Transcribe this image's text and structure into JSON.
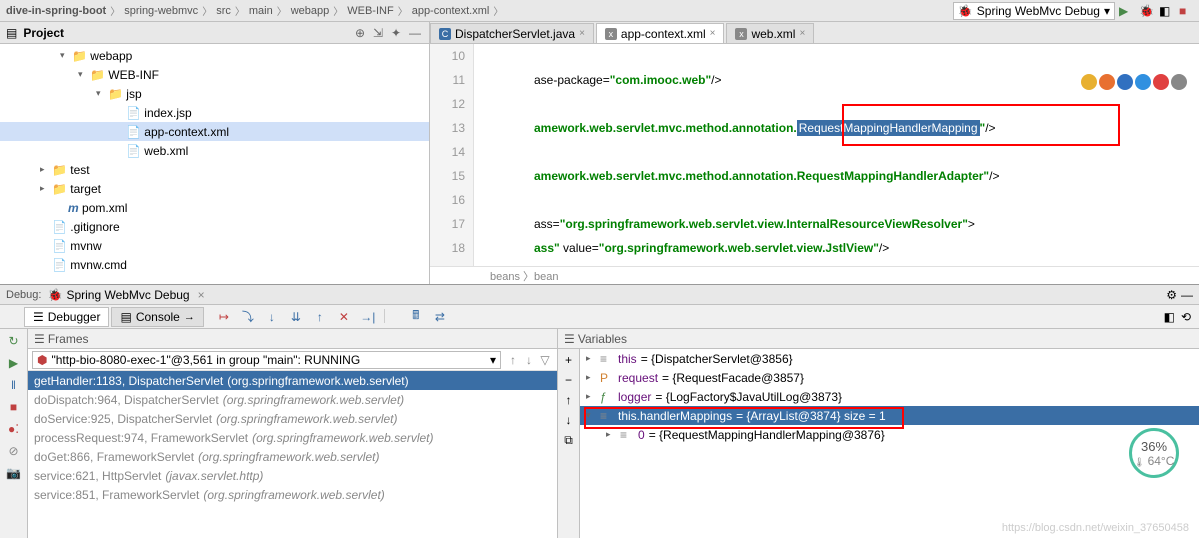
{
  "breadcrumb": [
    "dive-in-spring-boot",
    "spring-webmvc",
    "src",
    "main",
    "webapp",
    "WEB-INF",
    "app-context.xml"
  ],
  "run_config": "Spring WebMvc Debug",
  "project_panel": {
    "title": "Project",
    "tree": [
      {
        "indent": 0,
        "icon": "folder",
        "name": "webapp",
        "arrow": "▾"
      },
      {
        "indent": 1,
        "icon": "folder",
        "name": "WEB-INF",
        "arrow": "▾"
      },
      {
        "indent": 2,
        "icon": "folder",
        "name": "jsp",
        "arrow": "▾"
      },
      {
        "indent": 3,
        "icon": "file",
        "name": "index.jsp"
      },
      {
        "indent": 3,
        "icon": "xml",
        "name": "app-context.xml",
        "selected": true
      },
      {
        "indent": 3,
        "icon": "xml",
        "name": "web.xml"
      },
      {
        "indent": -1,
        "icon": "folder",
        "name": "test",
        "arrow": "▸",
        "pad": 40
      },
      {
        "indent": -1,
        "icon": "folder-orange",
        "name": "target",
        "arrow": "▸",
        "pad": 40
      },
      {
        "indent": -1,
        "icon": "maven",
        "name": "pom.xml",
        "pad": 56
      },
      {
        "indent": -1,
        "icon": "file",
        "name": ".gitignore",
        "pad": 40
      },
      {
        "indent": -1,
        "icon": "file",
        "name": "mvnw",
        "pad": 40
      },
      {
        "indent": -1,
        "icon": "file",
        "name": "mvnw.cmd",
        "pad": 40
      }
    ]
  },
  "editor": {
    "tabs": [
      {
        "name": "DispatcherServlet.java",
        "icon": "C"
      },
      {
        "name": "app-context.xml",
        "active": true,
        "icon": "x"
      },
      {
        "name": "web.xml",
        "icon": "x"
      }
    ],
    "lines": [
      {
        "num": 10,
        "text": ""
      },
      {
        "num": 11,
        "parts": [
          {
            "t": "ase-package=",
            "c": "punc"
          },
          {
            "t": "\"com.imooc.web\"",
            "c": "str"
          },
          {
            "t": "/>",
            "c": "punc"
          }
        ]
      },
      {
        "num": 12,
        "text": ""
      },
      {
        "num": 13,
        "parts": [
          {
            "t": "amework.web.servlet.mvc.method.annotation.",
            "c": "str"
          },
          {
            "t": "RequestMappingHandlerMapping",
            "c": "selected-text"
          },
          {
            "t": "\"",
            "c": "str"
          },
          {
            "t": "/>",
            "c": "punc"
          }
        ]
      },
      {
        "num": 14,
        "text": ""
      },
      {
        "num": 15,
        "parts": [
          {
            "t": "amework.web.servlet.mvc.method.annotation.RequestMappingHandlerAdapter\"",
            "c": "str"
          },
          {
            "t": "/>",
            "c": "punc"
          }
        ]
      },
      {
        "num": 16,
        "text": ""
      },
      {
        "num": 17,
        "parts": [
          {
            "t": "ass=",
            "c": "punc"
          },
          {
            "t": "\"org.springframework.web.servlet.view.InternalResourceViewResolver\"",
            "c": "str"
          },
          {
            "t": ">",
            "c": "punc"
          }
        ]
      },
      {
        "num": 18,
        "parts": [
          {
            "t": "ass\"",
            "c": "str"
          },
          {
            "t": " value=",
            "c": "punc"
          },
          {
            "t": "\"org.springframework.web.servlet.view.JstlView\"",
            "c": "str"
          },
          {
            "t": "/>",
            "c": "punc"
          }
        ]
      }
    ],
    "breadcrumb": "beans 〉bean"
  },
  "debug": {
    "header_label": "Debug:",
    "header_title": "Spring WebMvc Debug",
    "tabs": [
      "Debugger",
      "Console"
    ],
    "frames": {
      "title": "Frames",
      "thread": "\"http-bio-8080-exec-1\"@3,561 in group \"main\": RUNNING",
      "list": [
        {
          "method": "getHandler:1183, DispatcherServlet",
          "pkg": "(org.springframework.web.servlet)",
          "selected": true
        },
        {
          "method": "doDispatch:964, DispatcherServlet",
          "pkg": "(org.springframework.web.servlet)",
          "dim": true
        },
        {
          "method": "doService:925, DispatcherServlet",
          "pkg": "(org.springframework.web.servlet)",
          "dim": true
        },
        {
          "method": "processRequest:974, FrameworkServlet",
          "pkg": "(org.springframework.web.servlet)",
          "dim": true
        },
        {
          "method": "doGet:866, FrameworkServlet",
          "pkg": "(org.springframework.web.servlet)",
          "dim": true
        },
        {
          "method": "service:621, HttpServlet",
          "pkg": "(javax.servlet.http)",
          "dim": true
        },
        {
          "method": "service:851, FrameworkServlet",
          "pkg": "(org.springframework.web.servlet)",
          "dim": true
        }
      ]
    },
    "variables": {
      "title": "Variables",
      "list": [
        {
          "arrow": "▸",
          "icon": "≡",
          "name": "this",
          "val": "= {DispatcherServlet@3856}"
        },
        {
          "arrow": "▸",
          "icon": "P",
          "name": "request",
          "val": "= {RequestFacade@3857}"
        },
        {
          "arrow": "▸",
          "icon": "ƒ",
          "name": "logger",
          "val": "= {LogFactory$JavaUtilLog@3873}"
        },
        {
          "arrow": "▾",
          "icon": "≡",
          "name": "this.handlerMappings",
          "val": "= {ArrayList@3874} size = 1",
          "selected": true
        },
        {
          "arrow": "▸",
          "icon": "≡",
          "name": "0",
          "val": "= {RequestMappingHandlerMapping@3876}",
          "indent": 1,
          "boxed": true
        }
      ]
    }
  },
  "widget": {
    "pct": "36%",
    "temp": "64°C"
  },
  "watermark": "https://blog.csdn.net/weixin_37650458"
}
